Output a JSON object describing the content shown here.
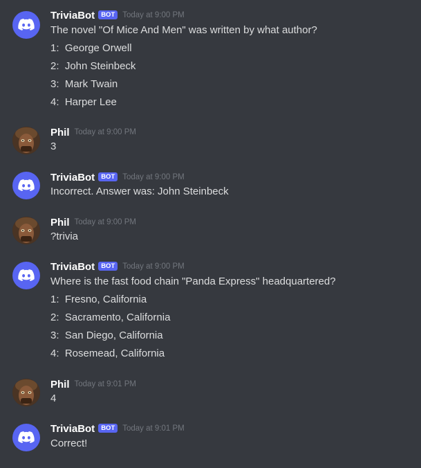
{
  "messages": [
    {
      "author": "TriviaBot",
      "tag": "BOT",
      "timestamp": "Today at 9:00 PM",
      "lines": [
        "The novel \"Of Mice And Men\" was written by what author?",
        "1:  George Orwell",
        "2:  John Steinbeck",
        "3:  Mark Twain",
        "4:  Harper Lee"
      ]
    },
    {
      "author": "Phil",
      "timestamp": "Today at 9:00 PM",
      "lines": [
        "3"
      ]
    },
    {
      "author": "TriviaBot",
      "tag": "BOT",
      "timestamp": "Today at 9:00 PM",
      "lines": [
        "Incorrect. Answer was: John Steinbeck"
      ]
    },
    {
      "author": "Phil",
      "timestamp": "Today at 9:00 PM",
      "lines": [
        "?trivia"
      ]
    },
    {
      "author": "TriviaBot",
      "tag": "BOT",
      "timestamp": "Today at 9:00 PM",
      "lines": [
        "Where is the fast food chain \"Panda Express\" headquartered?",
        "1:  Fresno, California",
        "2:  Sacramento, California",
        "3:  San Diego, California",
        "4:  Rosemead, California"
      ]
    },
    {
      "author": "Phil",
      "timestamp": "Today at 9:01 PM",
      "lines": [
        "4"
      ]
    },
    {
      "author": "TriviaBot",
      "tag": "BOT",
      "timestamp": "Today at 9:01 PM",
      "lines": [
        "Correct!"
      ]
    }
  ],
  "icons": {
    "bot_avatar": "discord-logo-icon",
    "user_avatar": "user-avatar-icon"
  },
  "colors": {
    "background": "#36393f",
    "blurple": "#5865f2",
    "author": "#ffffff",
    "text": "#dcddde",
    "timestamp": "#72767d"
  }
}
